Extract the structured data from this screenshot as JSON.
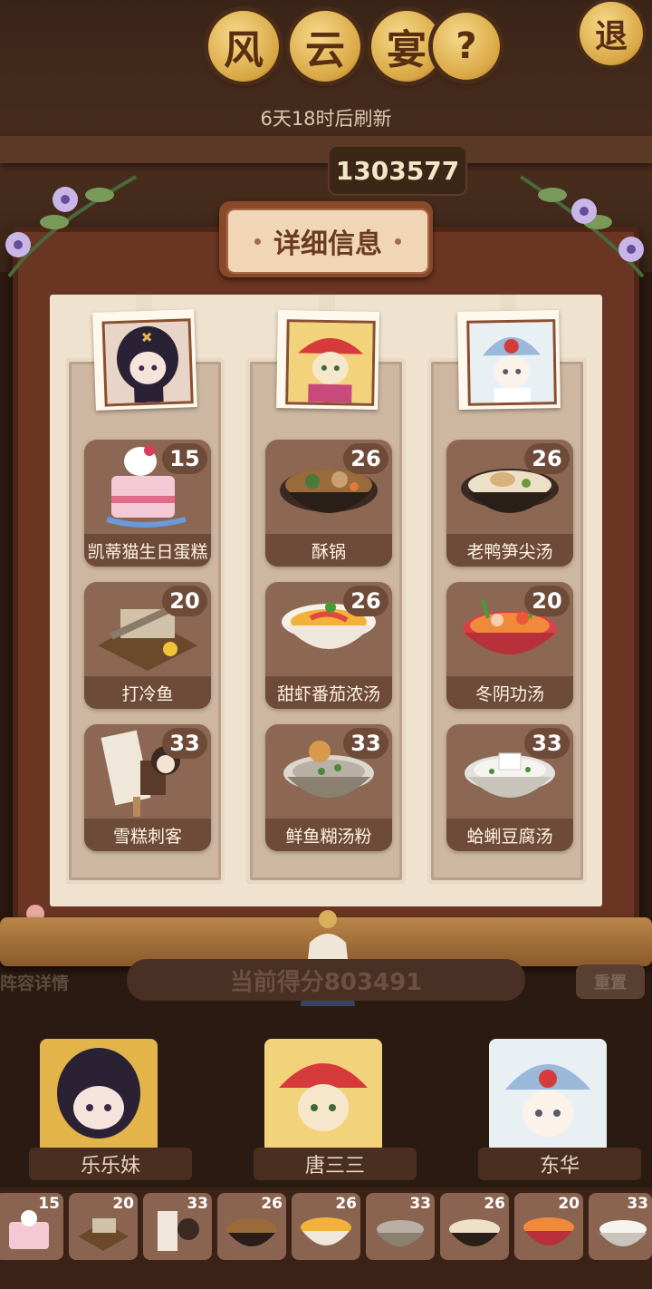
{
  "header": {
    "title_chars": [
      "风",
      "云",
      "宴"
    ],
    "help_label": "?",
    "exit_label": "退",
    "refresh_text": "6天18时后刷新",
    "top_score": "1303577"
  },
  "modal": {
    "title": "详细信息",
    "columns": [
      {
        "chef": "乐乐妹",
        "dishes": [
          {
            "name": "凯蒂猫生日蛋糕",
            "count": "15"
          },
          {
            "name": "打冷鱼",
            "count": "20"
          },
          {
            "name": "雪糕刺客",
            "count": "33"
          }
        ]
      },
      {
        "chef": "唐三三",
        "dishes": [
          {
            "name": "酥锅",
            "count": "26"
          },
          {
            "name": "甜虾番茄浓汤",
            "count": "26"
          },
          {
            "name": "鲜鱼糊汤粉",
            "count": "33"
          }
        ]
      },
      {
        "chef": "东华",
        "dishes": [
          {
            "name": "老鸭笋尖汤",
            "count": "26"
          },
          {
            "name": "冬阴功汤",
            "count": "20"
          },
          {
            "name": "蛤蜊豆腐汤",
            "count": "33"
          }
        ]
      }
    ]
  },
  "bottom": {
    "lineup_label": "阵容详情",
    "score_text": "当前得分803491",
    "reset_label": "重置",
    "chefs": [
      "乐乐妹",
      "唐三三",
      "东华"
    ],
    "tray_counts": [
      "15",
      "20",
      "33",
      "26",
      "26",
      "33",
      "26",
      "20",
      "33"
    ]
  },
  "colors": {
    "frame": "#6a3522",
    "paper": "#efe3cf",
    "dish_card": "#8c6753",
    "gold": "#d8a642"
  }
}
